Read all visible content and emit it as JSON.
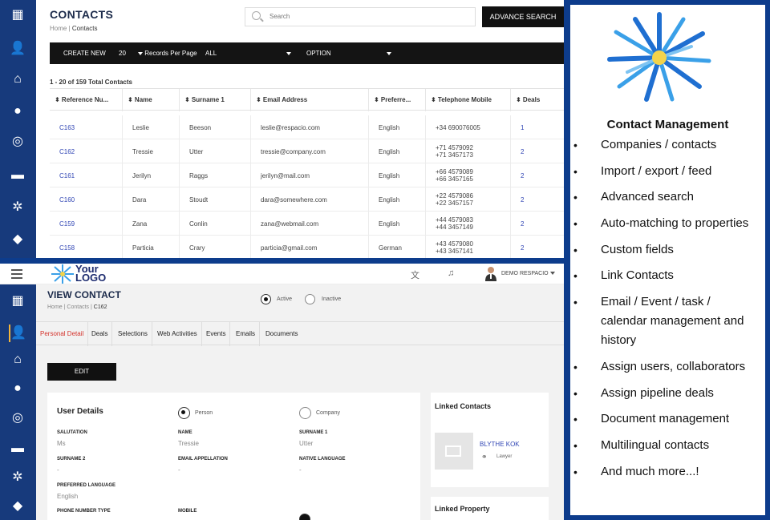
{
  "contacts_list": {
    "title": "CONTACTS",
    "breadcrumb": {
      "home": "Home",
      "sep": "|",
      "current": "Contacts"
    },
    "search_placeholder": "Search",
    "advance_search": "ADVANCE SEARCH",
    "toolbar": {
      "create_new": "CREATE NEW",
      "records_count": "20",
      "records_label": "Records Per Page",
      "all": "ALL",
      "option": "OPTION"
    },
    "total_text": "1 - 20 of 159 Total Contacts",
    "columns": [
      "⬍ Reference Nu...",
      "⬍ Name",
      "⬍ Surname 1",
      "⬍ Email Address",
      "⬍ Preferre...",
      "⬍ Telephone Mobile",
      "⬍ Deals"
    ],
    "rows": [
      {
        "ref": "C163",
        "name": "Leslie",
        "surname": "Beeson",
        "email": "leslie@respacio.com",
        "lang": "English",
        "phone": "+34 690076005",
        "deals": "1"
      },
      {
        "ref": "C162",
        "name": "Tressie",
        "surname": "Utter",
        "email": "tressie@company.com",
        "lang": "English",
        "phone": "+71 4579092\n+71 3457173",
        "deals": "2"
      },
      {
        "ref": "C161",
        "name": "Jerilyn",
        "surname": "Raggs",
        "email": "jerilyn@mail.com",
        "lang": "English",
        "phone": "+66 4579089\n+66 3457165",
        "deals": "2"
      },
      {
        "ref": "C160",
        "name": "Dara",
        "surname": "Stoudt",
        "email": "dara@somewhere.com",
        "lang": "English",
        "phone": "+22 4579086\n+22 3457157",
        "deals": "2"
      },
      {
        "ref": "C159",
        "name": "Zana",
        "surname": "Conlin",
        "email": "zana@webmail.com",
        "lang": "English",
        "phone": "+44 4579083\n+44 3457149",
        "deals": "2"
      },
      {
        "ref": "C158",
        "name": "Particia",
        "surname": "Crary",
        "email": "particia@gmail.com",
        "lang": "German",
        "phone": "+43 4579080\n+43 3457141",
        "deals": "2"
      }
    ]
  },
  "view_contact": {
    "logo": {
      "line1": "Your",
      "line2": "LOGO"
    },
    "user_label": "DEMO RESPACIO",
    "title": "VIEW CONTACT",
    "breadcrumb": {
      "home": "Home",
      "sep1": "|",
      "contacts": "Contacts",
      "sep2": "|",
      "current": "C162"
    },
    "status": {
      "active": "Active",
      "inactive": "Inactive"
    },
    "tabs": [
      "Personal Detail",
      "Deals",
      "Selections",
      "Web Activities",
      "Events",
      "Emails",
      "Documents"
    ],
    "edit": "EDIT",
    "user_details": {
      "title": "User Details",
      "type_person": "Person",
      "type_company": "Company",
      "salutation_label": "SALUTATION",
      "salutation": "Ms",
      "name_label": "NAME",
      "name": "Tressie",
      "surname1_label": "SURNAME 1",
      "surname1": "Utter",
      "surname2_label": "SURNAME 2",
      "surname2": "-",
      "appellation_label": "EMAIL APPELLATION",
      "appellation": "-",
      "native_label": "NATIVE LANGUAGE",
      "native": "-",
      "preferred_label": "PREFERRED LANGUAGE",
      "preferred": "English",
      "phone_type_label": "PHONE NUMBER TYPE",
      "mobile_label": "MOBILE"
    },
    "linked_contacts": {
      "title": "Linked Contacts",
      "name": "BLYTHE KOK",
      "role": "Lawyer"
    },
    "linked_property": {
      "title": "Linked Property"
    }
  },
  "features": {
    "heading": "Contact Management",
    "items": [
      "Companies / contacts",
      "Import / export / feed",
      "Advanced search",
      "Auto-matching to properties",
      "Custom fields",
      "Link Contacts",
      "Email / Event  / task / calendar management and history",
      "Assign users, collaborators",
      "Assign pipeline deals",
      "Document management",
      "Multilingual contacts",
      "And much more...!"
    ]
  }
}
